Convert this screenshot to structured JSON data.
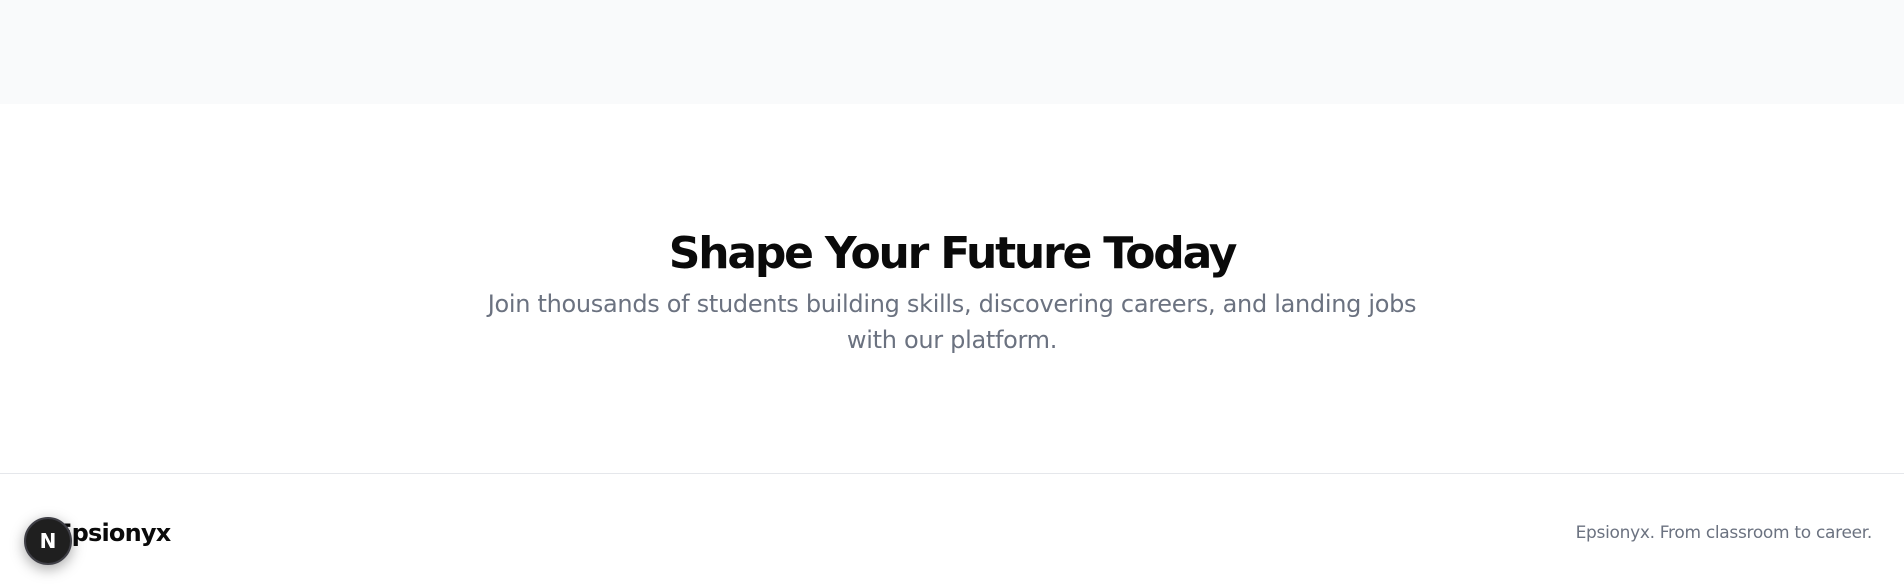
{
  "hero": {
    "title": "Shape Your Future Today",
    "subtitle": "Join thousands of students building skills, discovering careers, and landing jobs with our platform."
  },
  "footer": {
    "brand_name": "Epsionyx",
    "tagline": "Epsionyx. From classroom to career."
  },
  "dev_badge": {
    "letter": "N"
  },
  "colors": {
    "top_band": "#f9fafb",
    "title": "#0a0a0a",
    "muted_text": "#6b7280",
    "border": "#e5e7eb"
  }
}
